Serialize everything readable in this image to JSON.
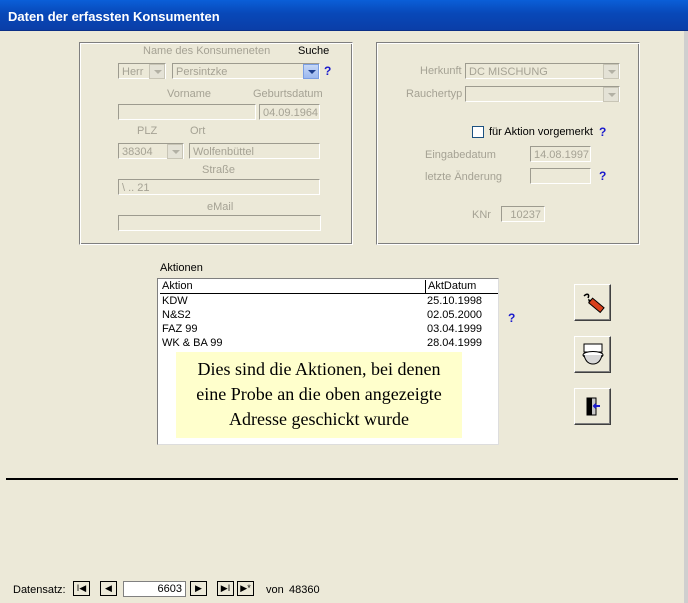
{
  "window": {
    "title": "Daten der erfassten Konsumenten"
  },
  "consumer": {
    "name_label": "Name des Konsumeneten",
    "search_label": "Suche",
    "salutation": "Herr",
    "name": "Persintzke",
    "firstname_label": "Vorname",
    "birthdate_label": "Geburtsdatum",
    "firstname": "",
    "birthdate": "04.09.1964",
    "plz_label": "PLZ",
    "city_label": "Ort",
    "plz": "38304",
    "city": "Wolfenbüttel",
    "street_label": "Straße",
    "street": "\\ .. 21",
    "email_label": "eMail",
    "email": ""
  },
  "origin": {
    "herkunft_label": "Herkunft",
    "herkunft": "DC MISCHUNG",
    "rauchertyp_label": "Rauchertyp",
    "rauchertyp": "",
    "aktion_checkbox_label": "für Aktion vorgemerkt",
    "eingabedatum_label": "Eingabedatum",
    "eingabedatum": "14.08.1997",
    "aenderung_label": "letzte Änderung",
    "aenderung": "",
    "knr_label": "KNr",
    "knr": "10237"
  },
  "help_glyph": "?",
  "aktionen": {
    "label": "Aktionen",
    "columns": [
      "Aktion",
      "AktDatum"
    ],
    "rows": [
      {
        "aktion": "KDW",
        "datum": "25.10.1998"
      },
      {
        "aktion": "N&S2",
        "datum": "02.05.2000"
      },
      {
        "aktion": "FAZ 99",
        "datum": "03.04.1999"
      },
      {
        "aktion": "WK & BA 99",
        "datum": "28.04.1999"
      }
    ],
    "note_line1": "Dies sind die Aktionen, bei denen",
    "note_line2": "eine Probe an die oben angezeigte",
    "note_line3": "Adresse geschickt wurde"
  },
  "buttons": {
    "edit_icon": "pen-icon",
    "toilet_icon": "toilet-icon",
    "exit_icon": "exit-door-icon"
  },
  "navigation": {
    "label": "Datensatz:",
    "current": "6603",
    "of_label": "von",
    "total": "48360",
    "first": "I◀",
    "prev": "◀",
    "next": "▶",
    "last": "▶I",
    "new": "▶*"
  }
}
